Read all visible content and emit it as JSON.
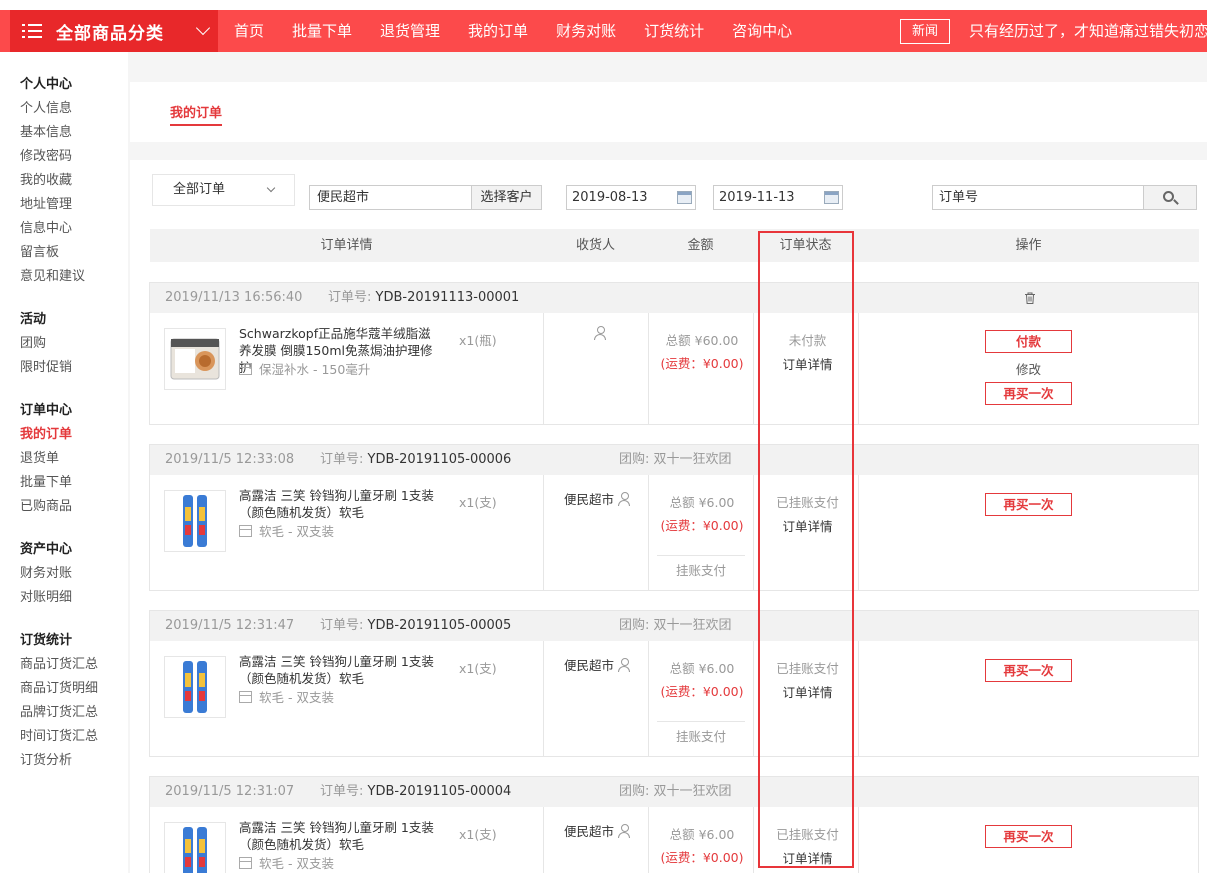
{
  "nav": {
    "category_label": "全部商品分类",
    "links": [
      "首页",
      "批量下单",
      "退货管理",
      "我的订单",
      "财务对账",
      "订货统计",
      "咨询中心"
    ],
    "news_button": "新闻",
    "slogan": "只有经历过了，才知道痛过错失初恋!"
  },
  "sidebar": {
    "groups": [
      {
        "title": "个人中心",
        "items": [
          "个人信息",
          "基本信息",
          "修改密码",
          "我的收藏",
          "地址管理",
          "信息中心",
          "留言板",
          "意见和建议"
        ]
      },
      {
        "title": "活动",
        "items": [
          "团购",
          "限时促销"
        ]
      },
      {
        "title": "订单中心",
        "items": [
          "我的订单",
          "退货单",
          "批量下单",
          "已购商品"
        ]
      },
      {
        "title": "资产中心",
        "items": [
          "财务对账",
          "对账明细"
        ]
      },
      {
        "title": "订货统计",
        "items": [
          "商品订货汇总",
          "商品订货明细",
          "品牌订货汇总",
          "时间订货汇总",
          "订货分析"
        ]
      }
    ],
    "active_item": "我的订单"
  },
  "tab": {
    "label": "我的订单"
  },
  "filters": {
    "status_select": "全部订单",
    "customer_value": "便民超市",
    "customer_button": "选择客户",
    "date_from": "2019-08-13",
    "date_to": "2019-11-13",
    "search_placeholder": "订单号"
  },
  "table_header": {
    "detail": "订单详情",
    "receiver": "收货人",
    "amount": "金额",
    "status": "订单状态",
    "actions": "操作"
  },
  "orders": [
    {
      "time": "2019/11/13 16:56:40",
      "order_no_label": "订单号:",
      "order_no": "YDB-20191113-00001",
      "group": "",
      "product_name": "Schwarzkopf正品施华蔻羊绒脂滋养发膜 倒膜150ml免蒸焗油护理修护",
      "spec": "保湿补水 - 150毫升",
      "qty": "x1(瓶)",
      "receiver": "",
      "total": "总额 ¥60.00",
      "shipping": "(运费：¥0.00)",
      "credit": "",
      "status": "未付款",
      "detail_link": "订单详情",
      "pay_button": "付款",
      "modify_link": "修改",
      "rebuy_button": "再买一次"
    },
    {
      "time": "2019/11/5 12:33:08",
      "order_no_label": "订单号:",
      "order_no": "YDB-20191105-00006",
      "group": "团购: 双十一狂欢团",
      "product_name": "高露洁 三笑 铃铛狗儿童牙刷 1支装（颜色随机发货）软毛",
      "spec": "软毛 - 双支装",
      "qty": "x1(支)",
      "receiver": "便民超市",
      "total": "总额 ¥6.00",
      "shipping": "(运费：¥0.00)",
      "credit": "挂账支付",
      "status": "已挂账支付",
      "detail_link": "订单详情",
      "rebuy_button": "再买一次"
    },
    {
      "time": "2019/11/5 12:31:47",
      "order_no_label": "订单号:",
      "order_no": "YDB-20191105-00005",
      "group": "团购: 双十一狂欢团",
      "product_name": "高露洁 三笑 铃铛狗儿童牙刷 1支装（颜色随机发货）软毛",
      "spec": "软毛 - 双支装",
      "qty": "x1(支)",
      "receiver": "便民超市",
      "total": "总额 ¥6.00",
      "shipping": "(运费：¥0.00)",
      "credit": "挂账支付",
      "status": "已挂账支付",
      "detail_link": "订单详情",
      "rebuy_button": "再买一次"
    },
    {
      "time": "2019/11/5 12:31:07",
      "order_no_label": "订单号:",
      "order_no": "YDB-20191105-00004",
      "group": "团购: 双十一狂欢团",
      "product_name": "高露洁 三笑 铃铛狗儿童牙刷 1支装（颜色随机发货）软毛",
      "spec": "软毛 - 双支装",
      "qty": "x1(支)",
      "receiver": "便民超市",
      "total": "总额 ¥6.00",
      "shipping": "(运费：¥0.00)",
      "credit": "",
      "status": "已挂账支付",
      "detail_link": "订单详情",
      "rebuy_button": "再买一次"
    }
  ],
  "colors": {
    "brand": "#fc4a4b",
    "accent": "#e4393c",
    "highlight_box": "#e8353a"
  }
}
